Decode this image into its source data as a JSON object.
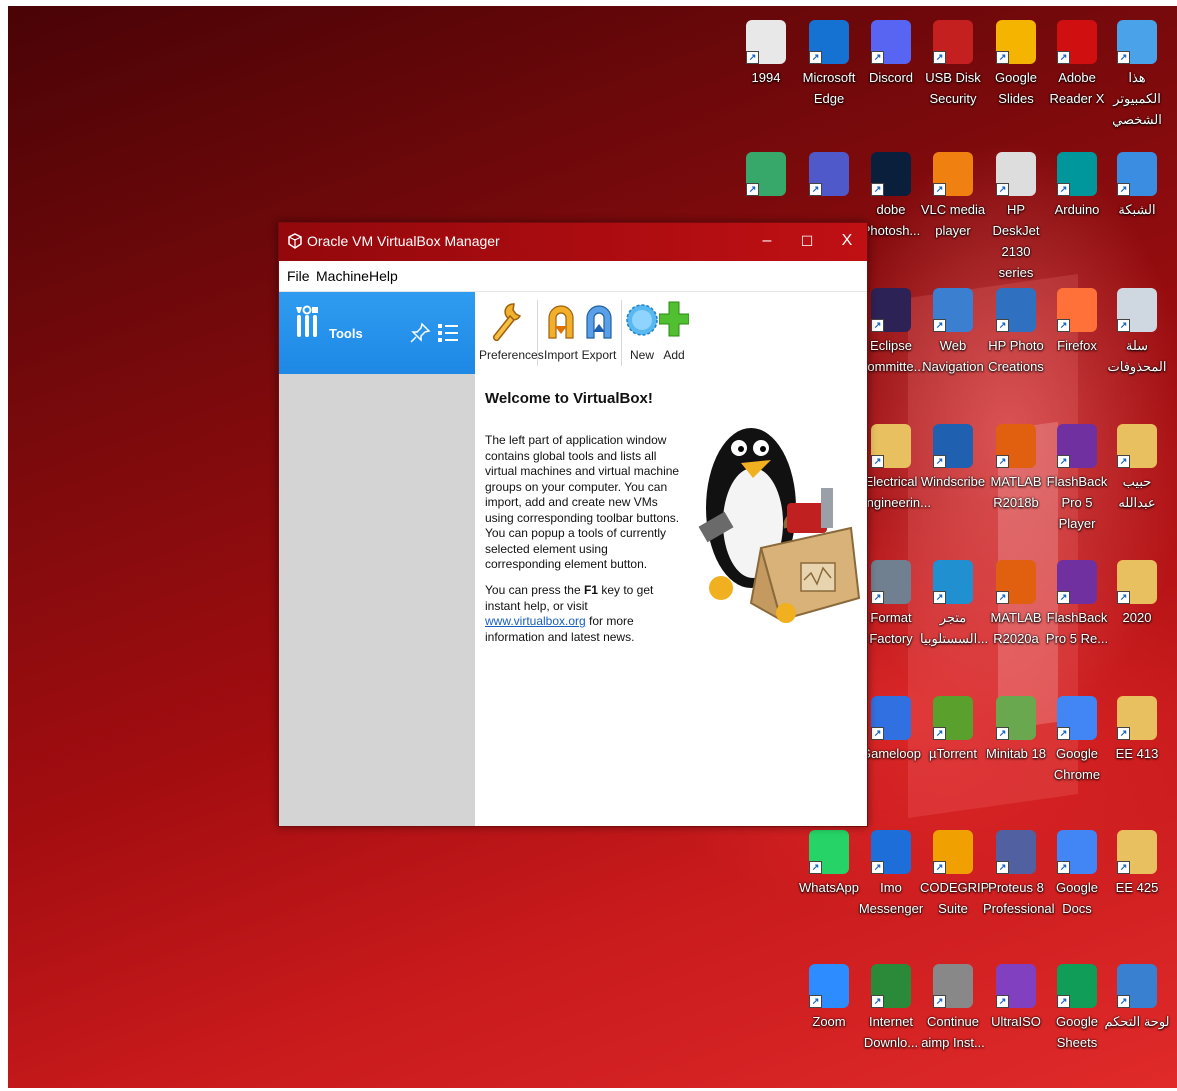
{
  "desktop": {
    "icons": [
      {
        "label": "1994",
        "icon": "document-icon",
        "color": "#e8e8e8"
      },
      {
        "label": "Microsoft\nEdge",
        "icon": "edge-icon",
        "color": "#1572d3"
      },
      {
        "label": "Discord",
        "icon": "discord-icon",
        "color": "#5865f2"
      },
      {
        "label": "USB Disk\nSecurity",
        "icon": "shield-icon",
        "color": "#c42020"
      },
      {
        "label": "Google Slides",
        "icon": "slides-icon",
        "color": "#f4b400"
      },
      {
        "label": "Adobe\nReader X",
        "icon": "pdf-icon",
        "color": "#d01010"
      },
      {
        "label": "هذا الكمبيوتر\nالشخصي",
        "icon": "computer-icon",
        "color": "#4aa3e8"
      },
      {
        "label": "",
        "icon": "app-green-icon",
        "color": "#38a86a"
      },
      {
        "label": "",
        "icon": "teams-icon",
        "color": "#5059c9"
      },
      {
        "label": "dobe\nPhotosh...",
        "icon": "photoshop-icon",
        "color": "#0a1f3c"
      },
      {
        "label": "VLC media\nplayer",
        "icon": "vlc-icon",
        "color": "#f08010"
      },
      {
        "label": "HP DeskJet\n2130 series",
        "icon": "printer-icon",
        "color": "#dddddd"
      },
      {
        "label": "Arduino",
        "icon": "arduino-icon",
        "color": "#00979c"
      },
      {
        "label": "الشبكة",
        "icon": "network-icon",
        "color": "#3a8de0"
      },
      {
        "label": "Eclipse\nCommitte...",
        "icon": "eclipse-icon",
        "color": "#2c2255"
      },
      {
        "label": "Web\nNavigation",
        "icon": "globe-icon",
        "color": "#3a7fd0"
      },
      {
        "label": "HP Photo\nCreations",
        "icon": "photo-icon",
        "color": "#3070c0"
      },
      {
        "label": "Firefox",
        "icon": "firefox-icon",
        "color": "#ff7139"
      },
      {
        "label": "سلة\nالمحذوفات",
        "icon": "recycle-bin-icon",
        "color": "#cfd8e0"
      },
      {
        "label": "Electrical\nEngineerin...",
        "icon": "folder-icon",
        "color": "#e8c060"
      },
      {
        "label": "Windscribe",
        "icon": "windscribe-icon",
        "color": "#2060b0"
      },
      {
        "label": "MATLAB\nR2018b",
        "icon": "matlab-icon",
        "color": "#e06010"
      },
      {
        "label": "FlashBack\nPro 5 Player",
        "icon": "flashback-icon",
        "color": "#7030a0"
      },
      {
        "label": "حبيب عبدالله",
        "icon": "user-folder-icon",
        "color": "#e8c060"
      },
      {
        "label": "Format\nFactory",
        "icon": "format-factory-icon",
        "color": "#708090"
      },
      {
        "label": "متجر\nالسستلوبيا...",
        "icon": "store-icon",
        "color": "#2090d0"
      },
      {
        "label": "MATLAB\nR2020a",
        "icon": "matlab-icon",
        "color": "#e06010"
      },
      {
        "label": "FlashBack\nPro 5 Re...",
        "icon": "flashback-icon",
        "color": "#7030a0"
      },
      {
        "label": "2020",
        "icon": "folder-doc-icon",
        "color": "#e8c060"
      },
      {
        "label": "Gameloop",
        "icon": "gameloop-icon",
        "color": "#3070e0"
      },
      {
        "label": "µTorrent",
        "icon": "utorrent-icon",
        "color": "#5aa02c"
      },
      {
        "label": "Minitab 18",
        "icon": "minitab-icon",
        "color": "#6aa84f"
      },
      {
        "label": "Google\nChrome",
        "icon": "chrome-icon",
        "color": "#4285f4"
      },
      {
        "label": "EE 413",
        "icon": "folder-doc-icon",
        "color": "#e8c060"
      },
      {
        "label": "WhatsApp",
        "icon": "whatsapp-icon",
        "color": "#25d366"
      },
      {
        "label": "Imo\nMessenger",
        "icon": "imo-icon",
        "color": "#1d6ed8"
      },
      {
        "label": "CODEGRIP\nSuite",
        "icon": "codegrip-icon",
        "color": "#f0a000"
      },
      {
        "label": "Proteus 8\nProfessional",
        "icon": "proteus-icon",
        "color": "#5060a0"
      },
      {
        "label": "Google Docs",
        "icon": "docs-icon",
        "color": "#4285f4"
      },
      {
        "label": "EE 425",
        "icon": "folder-doc-icon",
        "color": "#e8c060"
      },
      {
        "label": "Zoom",
        "icon": "zoom-icon",
        "color": "#2d8cff"
      },
      {
        "label": "Internet\nDownlo...",
        "icon": "idm-icon",
        "color": "#2a8a3a"
      },
      {
        "label": "Continue\naimp Inst...",
        "icon": "installer-icon",
        "color": "#888888"
      },
      {
        "label": "UltraISO",
        "icon": "disc-icon",
        "color": "#8040c0"
      },
      {
        "label": "Google\nSheets",
        "icon": "sheets-icon",
        "color": "#0f9d58"
      },
      {
        "label": "لوحة التحكم",
        "icon": "control-panel-icon",
        "color": "#3a80d0"
      }
    ]
  },
  "window": {
    "title": "Oracle VM VirtualBox Manager",
    "controls": {
      "minimize": "–",
      "maximize": "☐",
      "close": "X"
    },
    "menu": [
      "File",
      "Machine",
      "Help"
    ],
    "sidebar": {
      "tools_label": "Tools"
    },
    "toolbar": {
      "preferences": "Preferences",
      "import": "Import",
      "export": "Export",
      "new": "New",
      "add": "Add"
    },
    "welcome": {
      "title": "Welcome to VirtualBox!",
      "para1": "The left part of application window contains global tools and lists all virtual machines and virtual machine groups on your computer. You can import, add and create new VMs using corresponding toolbar buttons. You can popup a tools of currently selected element using corresponding element button.",
      "para2_a": "You can press the ",
      "para2_key": "F1",
      "para2_b": " key to get instant help, or visit ",
      "para2_link": "www.virtualbox.org",
      "para2_c": " for more information and latest news."
    },
    "colors": {
      "titlebar": "#b00d10",
      "tools_selected": "#2a94ec",
      "sidebar": "#d4d4d4"
    }
  }
}
